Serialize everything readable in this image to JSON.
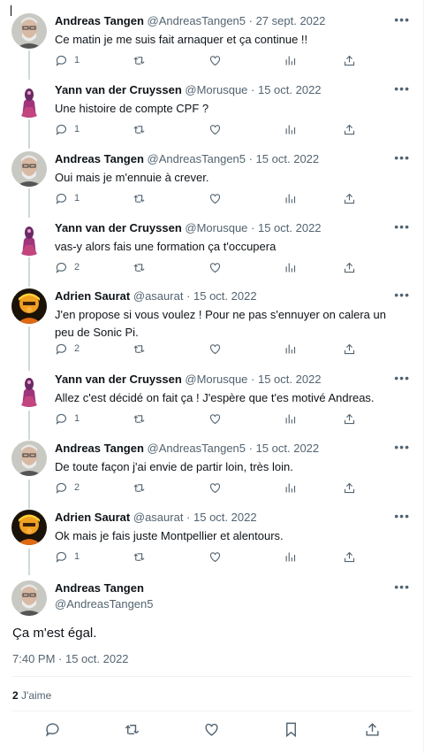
{
  "tweets": [
    {
      "name": "Andreas Tangen",
      "handle": "@AndreasTangen5",
      "date": "27 sept. 2022",
      "text": "Ce matin je me suis fait arnaquer et ça continue !!",
      "replies": "1"
    },
    {
      "name": "Yann van der Cruyssen",
      "handle": "@Morusque",
      "date": "15 oct. 2022",
      "text": "Une histoire de compte CPF ?",
      "replies": "1"
    },
    {
      "name": "Andreas Tangen",
      "handle": "@AndreasTangen5",
      "date": "15 oct. 2022",
      "text": "Oui mais je m'ennuie à crever.",
      "replies": "1"
    },
    {
      "name": "Yann van der Cruyssen",
      "handle": "@Morusque",
      "date": "15 oct. 2022",
      "text": "vas-y alors fais une formation ça t'occupera",
      "replies": "2"
    },
    {
      "name": "Adrien Saurat",
      "handle": "@asaurat",
      "date": "15 oct. 2022",
      "text": "J'en propose si vous voulez ! Pour ne pas s'ennuyer on calera un peu de Sonic Pi.",
      "replies": "2"
    },
    {
      "name": "Yann van der Cruyssen",
      "handle": "@Morusque",
      "date": "15 oct. 2022",
      "text": "Allez c'est décidé on fait ça ! J'espère que t'es motivé Andreas.",
      "replies": "1"
    },
    {
      "name": "Andreas Tangen",
      "handle": "@AndreasTangen5",
      "date": "15 oct. 2022",
      "text": "De toute façon j'ai envie de partir loin, très loin.",
      "replies": "2"
    },
    {
      "name": "Adrien Saurat",
      "handle": "@asaurat",
      "date": "15 oct. 2022",
      "text": "Ok mais je fais juste Montpellier et alentours.",
      "replies": "1"
    }
  ],
  "main": {
    "name": "Andreas Tangen",
    "handle": "@AndreasTangen5",
    "text": "Ça m'est égal.",
    "timestamp": "7:40 PM · 15 oct. 2022",
    "likes_count": "2",
    "likes_label": "J'aime"
  },
  "icons": {
    "reply": "reply-icon",
    "retweet": "retweet-icon",
    "like": "like-icon",
    "views": "views-icon",
    "share": "share-icon",
    "bookmark": "bookmark-icon",
    "more": "more-icon"
  },
  "colors": {
    "text": "#0f1419",
    "secondary": "#536471",
    "thread_line": "#cfd9de",
    "divider": "#eff3f4"
  }
}
